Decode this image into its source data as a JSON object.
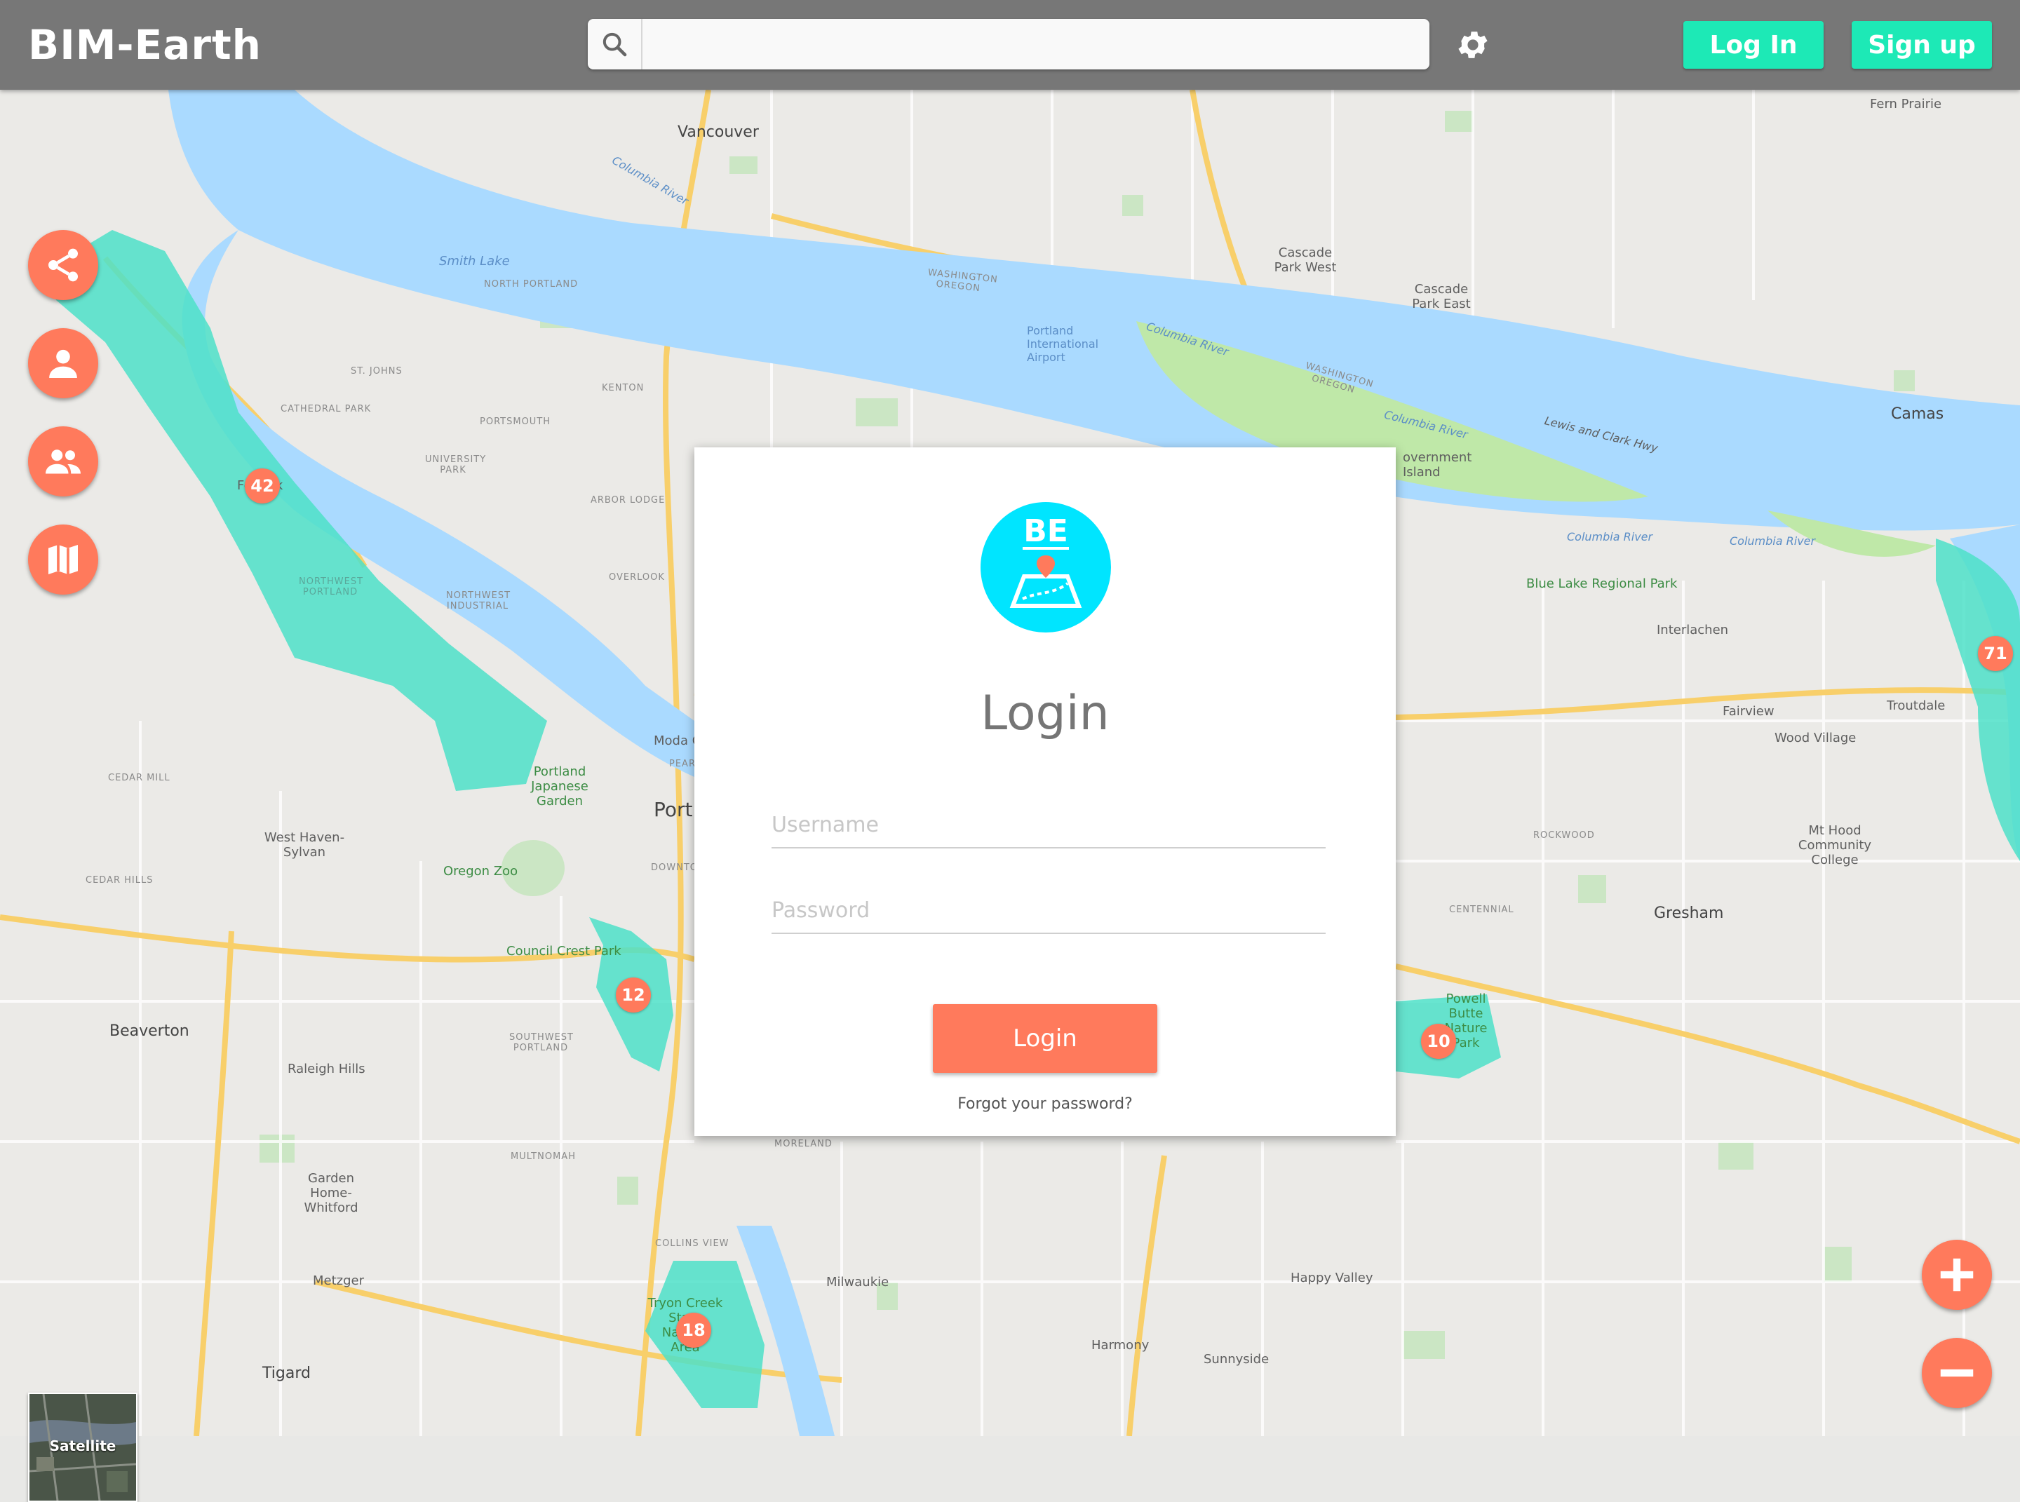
{
  "header": {
    "brand": "BIM-Earth",
    "search_placeholder": "",
    "login_label": "Log In",
    "signup_label": "Sign up",
    "settings_icon": "gear-icon",
    "search_icon": "search-icon"
  },
  "colors": {
    "header_bg": "#777777",
    "accent_green": "#1de9b6",
    "accent_coral": "#ff7a5c",
    "logo_cyan": "#00e5ff",
    "water": "#aadaff",
    "region_fill": "#4ee0c8"
  },
  "sidebar": {
    "buttons": [
      {
        "icon": "share-icon"
      },
      {
        "icon": "person-icon"
      },
      {
        "icon": "group-icon"
      },
      {
        "icon": "map-icon"
      }
    ]
  },
  "map": {
    "clusters": [
      "42",
      "71",
      "12",
      "10",
      "18"
    ],
    "labels": {
      "vancouver": "Vancouver",
      "fern_prairie": "Fern Prairie",
      "cascade_park_west": "Cascade Park West",
      "cascade_park_east": "Cascade Park East",
      "smith_lake": "Smith Lake",
      "north_portland": "NORTH PORTLAND",
      "portland_airport": "Portland International Airport",
      "st_johns": "ST. JOHNS",
      "kenton": "KENTON",
      "cathedral_park": "CATHEDRAL PARK",
      "portsmouth": "PORTSMOUTH",
      "university_park": "UNIVERSITY PARK",
      "arbor_lodge": "ARBOR LODGE",
      "overlook": "OVERLOOK",
      "government_island": "overnment Island",
      "camas": "Camas",
      "blue_lake": "Blue Lake Regional Park",
      "interlachen": "Interlachen",
      "fairview": "Fairview",
      "troutdale": "Troutdale",
      "wood_village": "Wood Village",
      "nw_industrial": "NORTHWEST INDUSTRIAL",
      "northwest_portland": "NORTHWEST PORTLAND",
      "forest_park": "Fo     Park",
      "cedar_mill": "CEDAR MILL",
      "cedar_hills": "CEDAR HILLS",
      "west_haven": "West Haven-Sylvan",
      "japanese_garden": "Portland Japanese Garden",
      "oregon_zoo": "Oregon Zoo",
      "port": "Port",
      "moda": "Moda C",
      "pearl": "PEARL DIST",
      "downtown": "DOWNTO",
      "council_crest": "Council Crest Park",
      "beaverton": "Beaverton",
      "raleigh_hills": "Raleigh Hills",
      "sw_portland": "SOUTHWEST PORTLAND",
      "rockwood": "ROCKWOOD",
      "mt_hood_cc": "Mt Hood Community College",
      "centennial": "CENTENNIAL",
      "gresham": "Gresham",
      "powell_butte": "Powell Butte Nature Park",
      "multnomah": "MULTNOMAH",
      "moreland": "MORELAND",
      "garden_home": "Garden Home-Whitford",
      "collins_view": "COLLINS VIEW",
      "tryon_creek": "Tryon Creek State Natural Area",
      "metzger": "Metzger",
      "milwaukie": "Milwaukie",
      "happy_valley": "Happy Valley",
      "harmony": "Harmony",
      "sunnyside": "Sunnyside",
      "tigard": "Tigard",
      "columbia_river_1": "Columbia River",
      "columbia_river_2": "Columbia River",
      "columbia_river_3": "Columbia River",
      "columbia_river_4": "Columbia River",
      "columbia_river_5": "Columbia River",
      "washington_oregon_1": "WASHINGTON OREGON",
      "washington_oregon_2": "WASHINGTON OREGON",
      "lewis_clark": "Lewis and Clark Hwy"
    },
    "satellite_label": "Satellite"
  },
  "zoom": {
    "in_icon": "plus-icon",
    "out_icon": "minus-icon"
  },
  "login": {
    "logo_text": "BE",
    "title": "Login",
    "username_placeholder": "Username",
    "password_placeholder": "Password",
    "submit_label": "Login",
    "forgot_label": "Forgot your password?"
  }
}
